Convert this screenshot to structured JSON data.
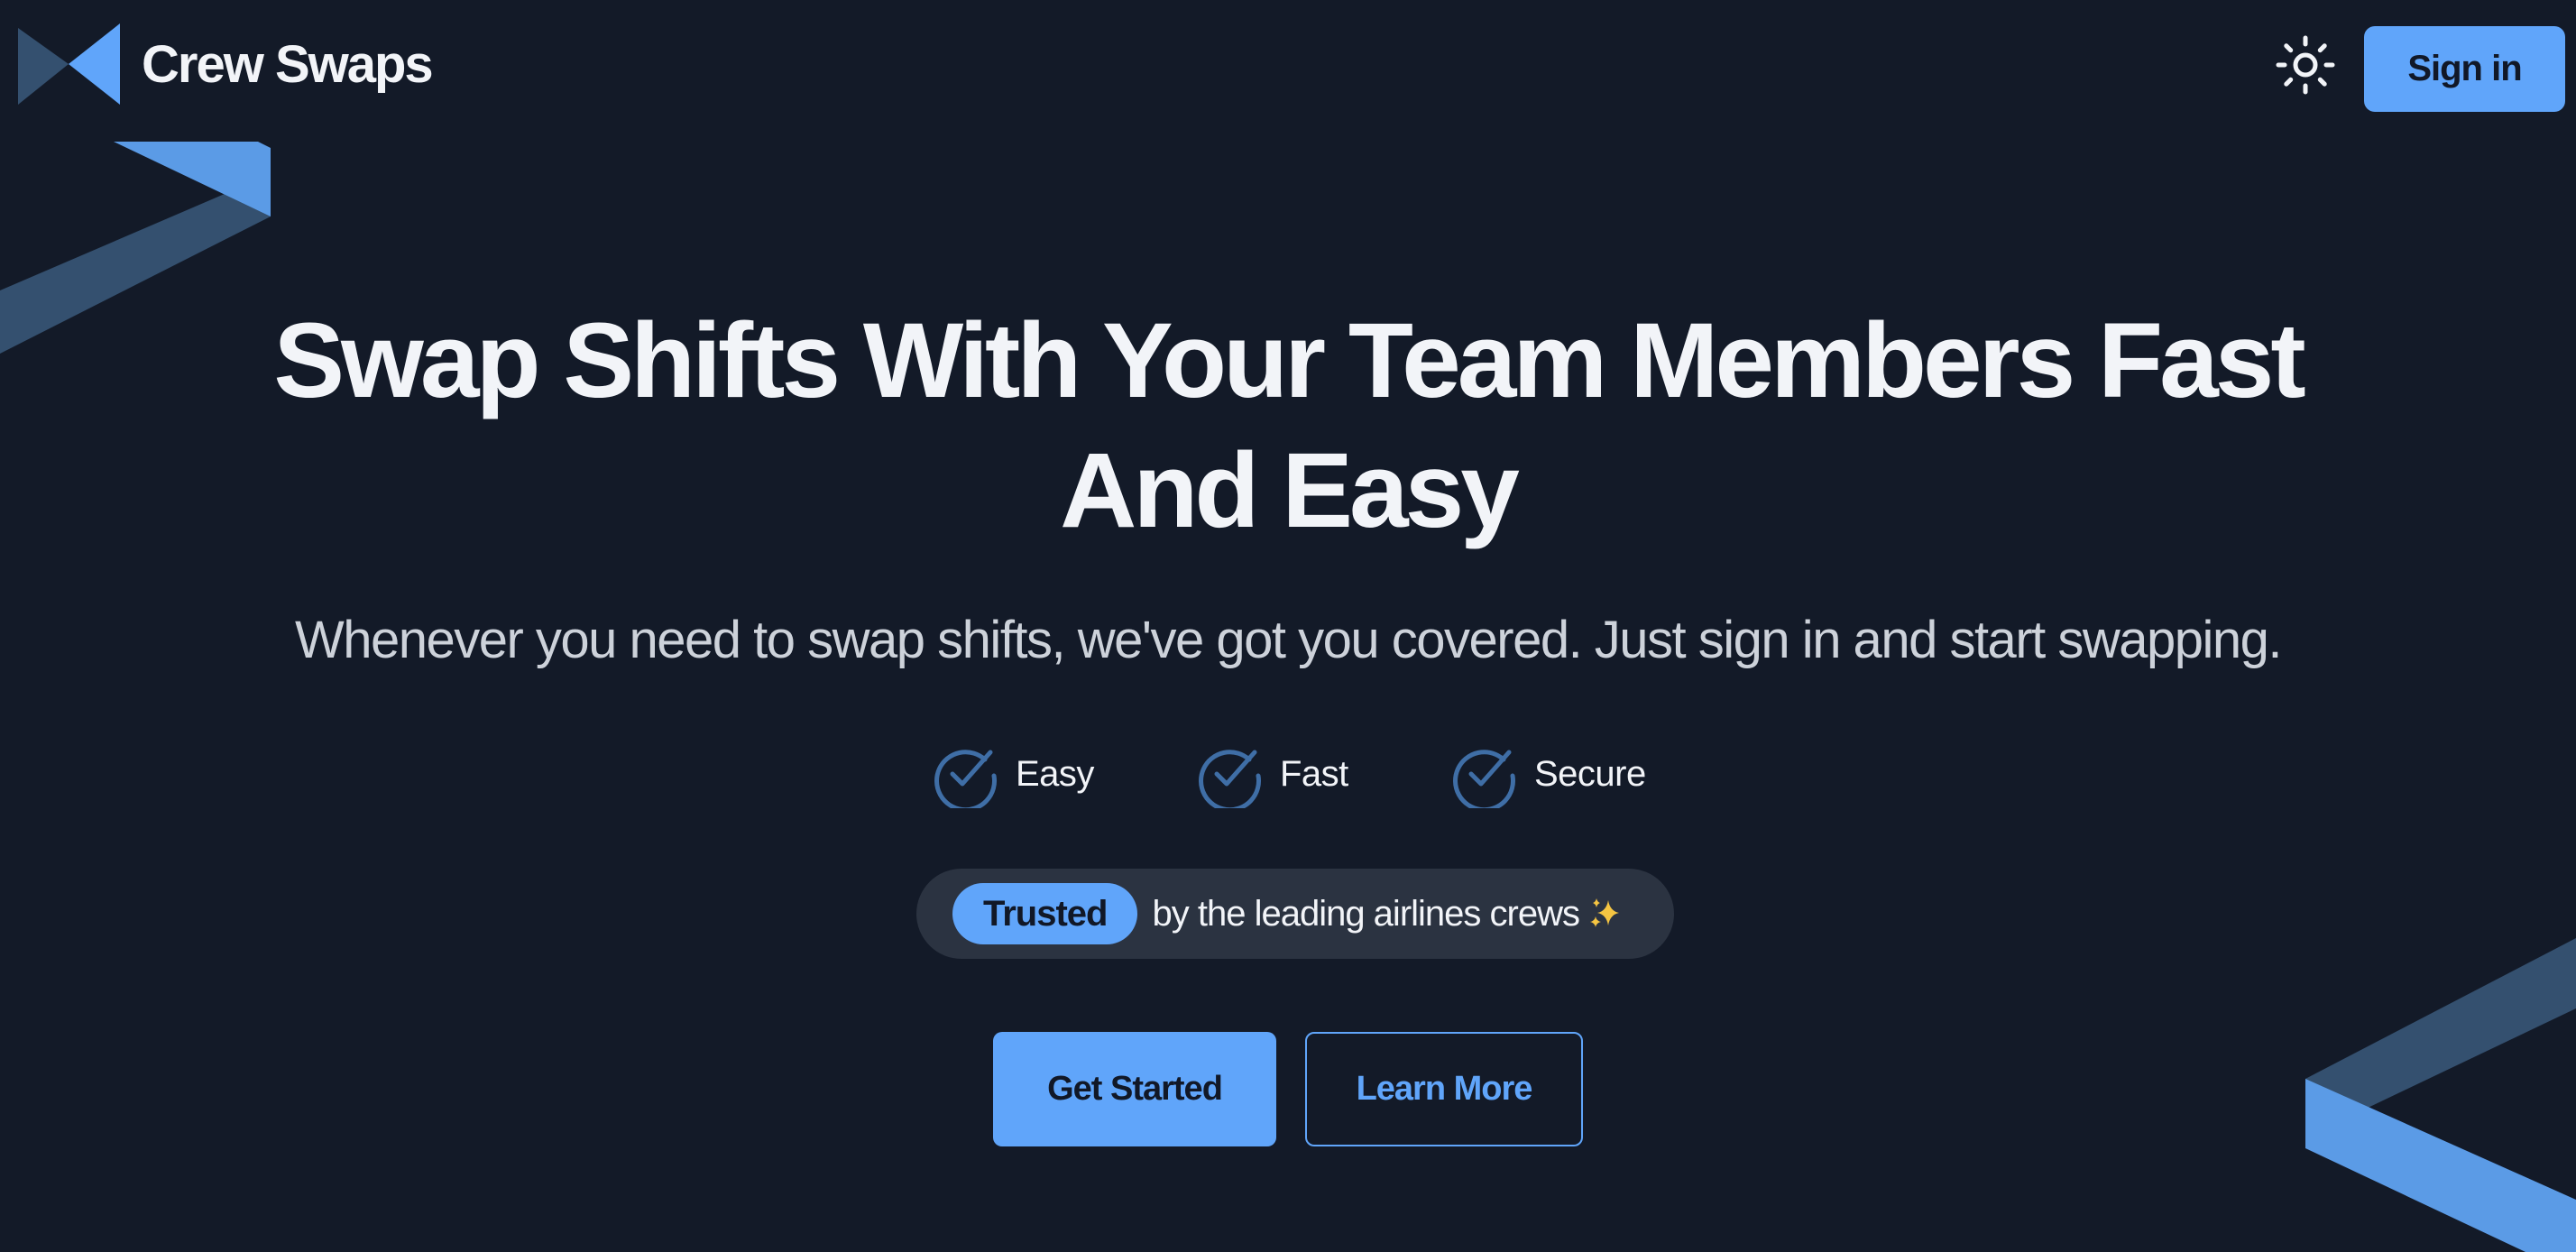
{
  "brand": {
    "name": "Crew Swaps",
    "logo_icon": "crew-swaps-logo"
  },
  "header": {
    "theme_toggle_icon": "sun-icon",
    "signin_label": "Sign in"
  },
  "hero": {
    "title_line1": "Swap Shifts With Your Team Members Fast",
    "title_line2": "And Easy",
    "subtitle": "Whenever you need to swap shifts, we've got you covered. Just sign in and start swapping."
  },
  "features": [
    {
      "label": "Easy",
      "icon": "check-circle-icon"
    },
    {
      "label": "Fast",
      "icon": "check-circle-icon"
    },
    {
      "label": "Secure",
      "icon": "check-circle-icon"
    }
  ],
  "trusted": {
    "badge": "Trusted",
    "text": "by the leading airlines crews",
    "icon": "sparkles-icon"
  },
  "cta": {
    "primary_label": "Get Started",
    "secondary_label": "Learn More"
  },
  "colors": {
    "background": "#131a28",
    "accent": "#60a5fa",
    "accent_dark": "#34506f",
    "text": "#f2f4f8",
    "muted_text": "#cdd2da",
    "pill_background": "#2b3341"
  }
}
